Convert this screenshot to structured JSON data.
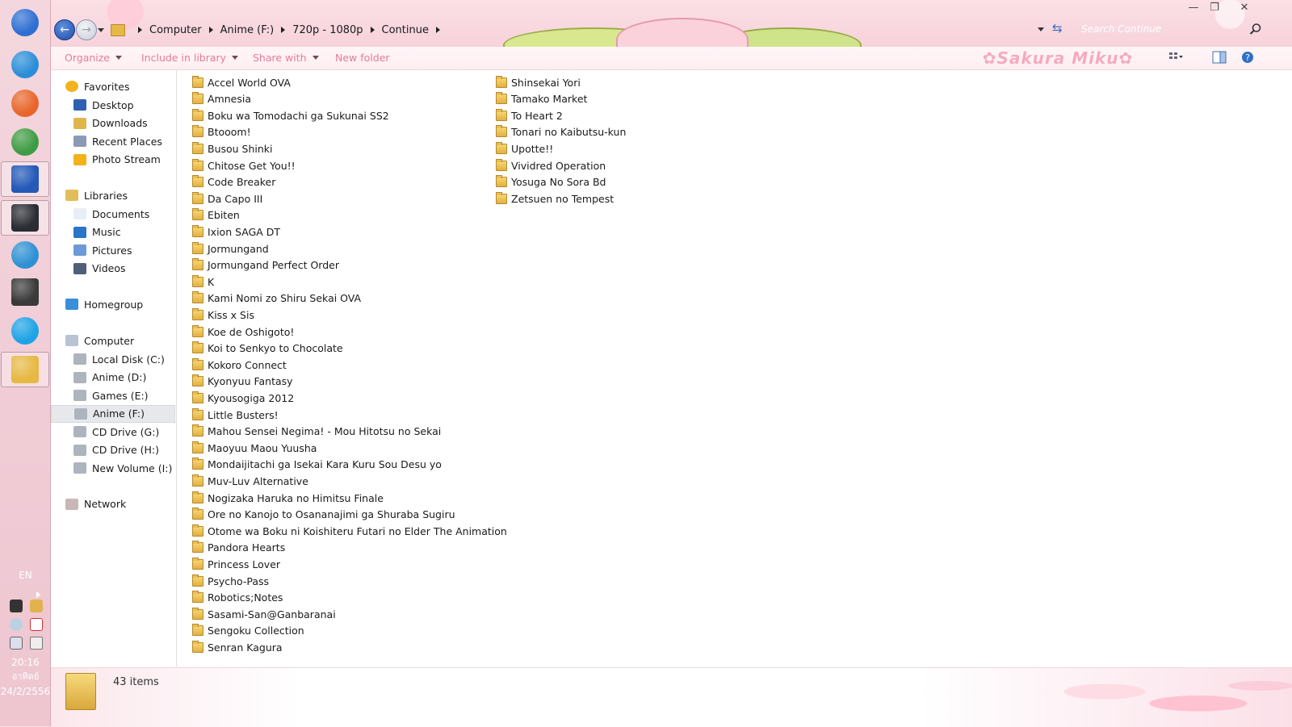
{
  "taskbar": {
    "pinned": [
      {
        "name": "windows-start-orb",
        "color": "#2f6fd2"
      },
      {
        "name": "internet-explorer-icon",
        "color": "#2b8ed8"
      },
      {
        "name": "firefox-icon",
        "color": "#e8662b"
      },
      {
        "name": "chrome-icon",
        "color": "#3f9c44"
      },
      {
        "name": "maxthon-icon",
        "color": "#2459b8"
      },
      {
        "name": "steam-icon",
        "color": "#2a2d33"
      },
      {
        "name": "network-globe-icon",
        "color": "#2e91d4"
      },
      {
        "name": "monitor-99-icon",
        "color": "#3a3a3a"
      },
      {
        "name": "skype-icon",
        "color": "#1ea3e5"
      },
      {
        "name": "windows-explorer-icon",
        "color": "#e6b944"
      }
    ],
    "language": "EN",
    "clock": {
      "time": "20:16",
      "day": "อาทิตย์",
      "date": "24/2/2556"
    }
  },
  "titlebar": {
    "breadcrumb": [
      "Computer",
      "Anime (F:)",
      "720p - 1080p",
      "Continue"
    ],
    "search_placeholder": "Search Continue"
  },
  "commandbar": {
    "organize": "Organize",
    "include_in_library": "Include in library",
    "share_with": "Share with",
    "new_folder": "New folder",
    "brand": "Sakura Miku"
  },
  "navpane": {
    "favorites": {
      "label": "Favorites",
      "items": [
        "Desktop",
        "Downloads",
        "Recent Places",
        "Photo Stream"
      ]
    },
    "libraries": {
      "label": "Libraries",
      "items": [
        "Documents",
        "Music",
        "Pictures",
        "Videos"
      ]
    },
    "homegroup": "Homegroup",
    "computer": {
      "label": "Computer",
      "items": [
        "Local Disk (C:)",
        "Anime (D:)",
        "Games (E:)",
        "Anime (F:)",
        "CD Drive (G:)",
        "CD Drive (H:)",
        "New Volume (I:)"
      ]
    },
    "selected": "Anime (F:)",
    "network": "Network"
  },
  "folders": [
    "Accel World OVA",
    "Amnesia",
    "Boku wa Tomodachi ga Sukunai SS2",
    "Btooom!",
    "Busou Shinki",
    "Chitose Get You!!",
    "Code Breaker",
    "Da Capo III",
    "Ebiten",
    "Ixion SAGA DT",
    "Jormungand",
    "Jormungand Perfect Order",
    "K",
    "Kami Nomi zo Shiru Sekai OVA",
    "Kiss x Sis",
    "Koe de Oshigoto!",
    "Koi to Senkyo to Chocolate",
    "Kokoro Connect",
    "Kyonyuu Fantasy",
    "Kyousogiga 2012",
    "Little Busters!",
    "Mahou Sensei Negima! - Mou Hitotsu no Sekai",
    "Maoyuu Maou Yuusha",
    "Mondaijitachi ga Isekai Kara Kuru Sou Desu yo",
    "Muv-Luv Alternative",
    "Nogizaka Haruka no Himitsu Finale",
    "Ore no Kanojo to Osananajimi ga Shuraba Sugiru",
    "Otome wa Boku ni Koishiteru Futari no Elder The Animation",
    "Pandora Hearts",
    "Princess Lover",
    "Psycho-Pass",
    "Robotics;Notes",
    "Sasami-San@Ganbaranai",
    "Sengoku Collection",
    "Senran Kagura",
    "Shinsekai Yori",
    "Tamako Market",
    "To Heart 2",
    "Tonari no Kaibutsu-kun",
    "Upotte!!",
    "Vividred Operation",
    "Yosuga No Sora Bd",
    "Zetsuen no Tempest"
  ],
  "details": {
    "item_count": "43 items"
  }
}
